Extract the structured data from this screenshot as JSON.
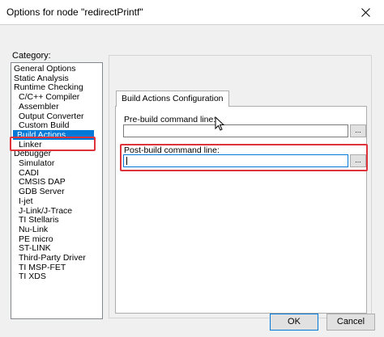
{
  "window": {
    "title": "Options for node \"redirectPrintf\"",
    "close_icon": "close-x"
  },
  "category": {
    "label": "Category:",
    "items": [
      {
        "label": "General Options",
        "level": 1
      },
      {
        "label": "Static Analysis",
        "level": 1
      },
      {
        "label": "Runtime Checking",
        "level": 1
      },
      {
        "label": "C/C++ Compiler",
        "level": 2
      },
      {
        "label": "Assembler",
        "level": 2
      },
      {
        "label": "Output Converter",
        "level": 2
      },
      {
        "label": "Custom Build",
        "level": 2
      },
      {
        "label": "Build Actions",
        "level": 2,
        "selected": true
      },
      {
        "label": "Linker",
        "level": 2
      },
      {
        "label": "Debugger",
        "level": 1
      },
      {
        "label": "Simulator",
        "level": 2
      },
      {
        "label": "CADI",
        "level": 2
      },
      {
        "label": "CMSIS DAP",
        "level": 2
      },
      {
        "label": "GDB Server",
        "level": 2
      },
      {
        "label": "I-jet",
        "level": 2
      },
      {
        "label": "J-Link/J-Trace",
        "level": 2
      },
      {
        "label": "TI Stellaris",
        "level": 2
      },
      {
        "label": "Nu-Link",
        "level": 2
      },
      {
        "label": "PE micro",
        "level": 2
      },
      {
        "label": "ST-LINK",
        "level": 2
      },
      {
        "label": "Third-Party Driver",
        "level": 2
      },
      {
        "label": "TI MSP-FET",
        "level": 2
      },
      {
        "label": "TI XDS",
        "level": 2
      }
    ]
  },
  "panel": {
    "tab_label": "Build Actions Configuration",
    "pre_build": {
      "label": "Pre-build command line:",
      "value": "",
      "browse_label": "..."
    },
    "post_build": {
      "label": "Post-build command line:",
      "value": "",
      "browse_label": "..."
    }
  },
  "buttons": {
    "ok": "OK",
    "cancel": "Cancel"
  },
  "colors": {
    "highlight": "#e0323a",
    "selection": "#0078d7"
  }
}
